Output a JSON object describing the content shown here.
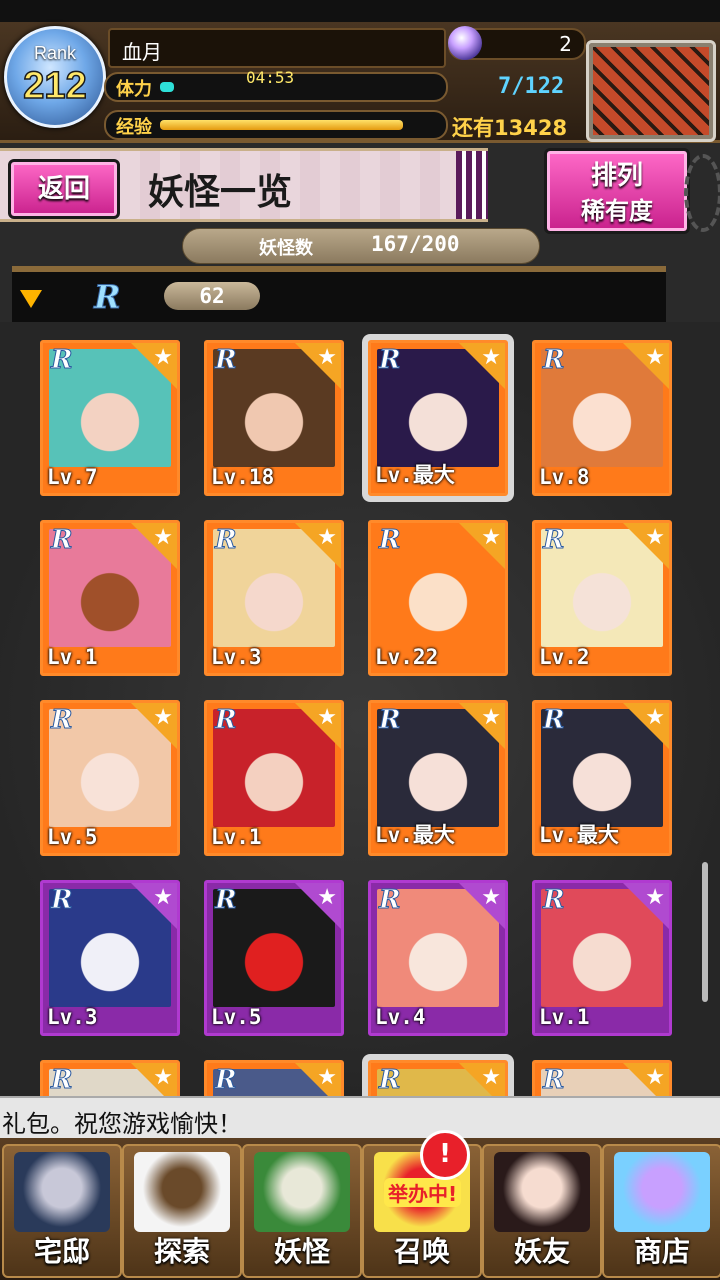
{
  "header": {
    "rank_label": "Rank",
    "rank_value": "212",
    "player_name": "血月",
    "stamina_label": "体力",
    "stamina_timer": "04:53",
    "stamina_fraction": 0.05,
    "exp_label": "经验",
    "exp_fraction": 0.88,
    "gem_count": "2",
    "storage": "7/122",
    "exp_remaining": "还有13428"
  },
  "titlebar": {
    "back_label": "返回",
    "title": "妖怪一览",
    "sort_label": "排列",
    "sort_mode": "稀有度"
  },
  "summary": {
    "count_label": "妖怪数",
    "count_value": "167/200"
  },
  "section": {
    "rarity": "R",
    "count": "62"
  },
  "cards": [
    {
      "level": "Lv.7",
      "frame": "orange",
      "portrait": [
        "#57c2b8",
        "#f3d2c2"
      ]
    },
    {
      "level": "Lv.18",
      "frame": "orange",
      "portrait": [
        "#5a3a22",
        "#f0c8b0"
      ]
    },
    {
      "level": "Lv.最大",
      "frame": "orange",
      "selected": true,
      "portrait": [
        "#2a1a4a",
        "#f4e0d8"
      ]
    },
    {
      "level": "Lv.8",
      "frame": "orange",
      "portrait": [
        "#e07a3a",
        "#fbe0d0"
      ]
    },
    {
      "level": "Lv.1",
      "frame": "orange",
      "portrait": [
        "#e87a9a",
        "#a0502a"
      ]
    },
    {
      "level": "Lv.3",
      "frame": "orange",
      "portrait": [
        "#f0d49a",
        "#f5d8cc"
      ]
    },
    {
      "level": "Lv.22",
      "frame": "orange",
      "portrait": [
        "#ff7a1a",
        "#fbe0c8"
      ]
    },
    {
      "level": "Lv.2",
      "frame": "orange",
      "portrait": [
        "#f4e8b8",
        "#f5e2d8"
      ]
    },
    {
      "level": "Lv.5",
      "frame": "orange",
      "portrait": [
        "#f2c8a8",
        "#f8e2d8"
      ]
    },
    {
      "level": "Lv.1",
      "frame": "orange",
      "portrait": [
        "#c8222a",
        "#f4d0c0"
      ]
    },
    {
      "level": "Lv.最大",
      "frame": "orange",
      "portrait": [
        "#2a2a3a",
        "#f6e0d8"
      ]
    },
    {
      "level": "Lv.最大",
      "frame": "orange",
      "portrait": [
        "#2a2a3a",
        "#f6e0d8"
      ]
    },
    {
      "level": "Lv.3",
      "frame": "purple",
      "portrait": [
        "#2a3a8a",
        "#f0f0f8"
      ]
    },
    {
      "level": "Lv.5",
      "frame": "purple",
      "portrait": [
        "#1a1a1a",
        "#e02020"
      ]
    },
    {
      "level": "Lv.4",
      "frame": "purple",
      "portrait": [
        "#f08a7a",
        "#f8e6dc"
      ]
    },
    {
      "level": "Lv.1",
      "frame": "purple",
      "portrait": [
        "#e04a5a",
        "#f6dcd0"
      ]
    },
    {
      "level": "",
      "frame": "orange",
      "portrait": [
        "#e0d8c8",
        "#f6dcd0"
      ]
    },
    {
      "level": "",
      "frame": "orange",
      "portrait": [
        "#4a5a8a",
        "#d8d8e8"
      ]
    },
    {
      "level": "",
      "frame": "orange",
      "selected": true,
      "portrait": [
        "#e0b84a",
        "#f6dcd0"
      ]
    },
    {
      "level": "",
      "frame": "orange",
      "portrait": [
        "#e8d0b8",
        "#f6dcd0"
      ]
    }
  ],
  "ticker": {
    "text": "礼包。祝您游戏愉快！"
  },
  "nav": [
    {
      "label": "宅邸",
      "art": [
        "#2a3a5a",
        "#c8c8d8"
      ]
    },
    {
      "label": "探索",
      "art": [
        "#f4f4f4",
        "#6a4a2a"
      ]
    },
    {
      "label": "妖怪",
      "art": [
        "#3a8a3a",
        "#e8e8d8"
      ]
    },
    {
      "label": "召唤",
      "art": [
        "#f8e04a",
        "#e8202a"
      ]
    },
    {
      "label": "妖友",
      "art": [
        "#2a1a1a",
        "#f6dcd0"
      ]
    },
    {
      "label": "商店",
      "art": [
        "#7ad0ff",
        "#c8a0ff"
      ]
    }
  ],
  "nav_badge": "!",
  "event_label": "举办中!",
  "colors": {
    "accent_pink": "#c8208c",
    "frame_orange": "#ff7a1a",
    "frame_purple": "#8a2aa8",
    "gold": "#ffd24a"
  }
}
